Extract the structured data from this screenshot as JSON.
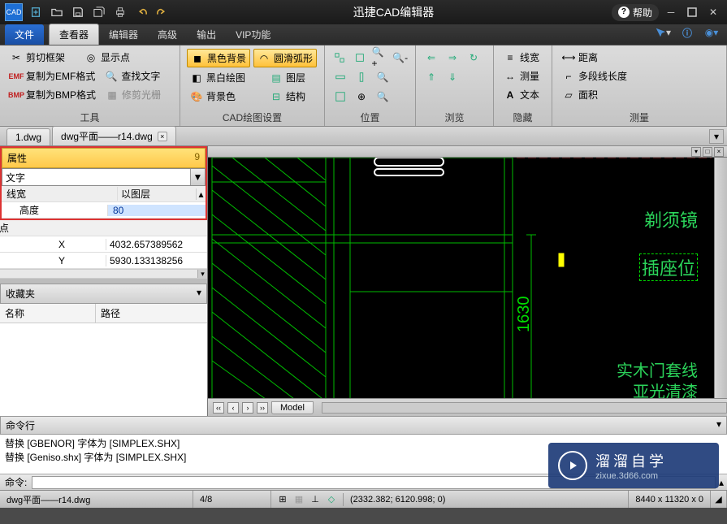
{
  "app": {
    "title": "迅捷CAD编辑器",
    "logo": "CAD",
    "help": "帮助"
  },
  "menus": {
    "file": "文件",
    "tabs": [
      "查看器",
      "编辑器",
      "高级",
      "输出",
      "VIP功能"
    ],
    "active": 0
  },
  "ribbon": {
    "groups": {
      "tools": {
        "label": "工具",
        "items": {
          "clip": "剪切框架",
          "showpt": "显示点",
          "emf": "复制为EMF格式",
          "findtxt": "查找文字",
          "bmp": "复制为BMP格式",
          "trimlight": "修剪光栅"
        }
      },
      "cad": {
        "label": "CAD绘图设置",
        "items": {
          "blackbg": "黑色背景",
          "arc": "圆滑弧形",
          "bw": "黑白绘图",
          "layer": "图层",
          "bgcolor": "背景色",
          "struct": "结构"
        }
      },
      "pos": {
        "label": "位置"
      },
      "view": {
        "label": "浏览"
      },
      "hide": {
        "label": "隐藏",
        "items": {
          "lw": "线宽",
          "meas": "测量",
          "text": "文本"
        }
      },
      "measure": {
        "label": "测量",
        "items": {
          "dist": "距离",
          "polylen": "多段线长度",
          "area": "面积"
        }
      }
    }
  },
  "doctabs": {
    "tabs": [
      "1.dwg",
      "dwg平面——r14.dwg"
    ],
    "active": 1
  },
  "props": {
    "header": "属性",
    "header_count": "9",
    "combo_value": "文字",
    "rows": {
      "lw": {
        "k": "线宽",
        "v": "以图层"
      },
      "height": {
        "k": "高度",
        "v": "80"
      },
      "section_pt": "点",
      "x": {
        "k": "X",
        "v": "4032.657389562"
      },
      "y": {
        "k": "Y",
        "v": "5930.133138256"
      }
    }
  },
  "fav": {
    "header": "收藏夹",
    "cols": {
      "name": "名称",
      "path": "路径"
    }
  },
  "canvas": {
    "labels": {
      "mirror": "剃须镜",
      "socket": "插座位",
      "dim": "1630",
      "wood": "实木门套线",
      "lacquer": "亚光清漆"
    },
    "model_tab": "Model"
  },
  "cmd": {
    "header": "命令行",
    "log1": "替换 [GBENOR] 字体为 [SIMPLEX.SHX]",
    "log2": "替换 [Geniso.shx] 字体为 [SIMPLEX.SHX]",
    "prompt": "命令:"
  },
  "status": {
    "file": "dwg平面——r14.dwg",
    "page": "4/8",
    "coords": "(2332.382; 6120.998; 0)",
    "dims": "8440 x 11320 x 0"
  },
  "watermark": {
    "brand": "溜溜自学",
    "url": "zixue.3d66.com"
  }
}
